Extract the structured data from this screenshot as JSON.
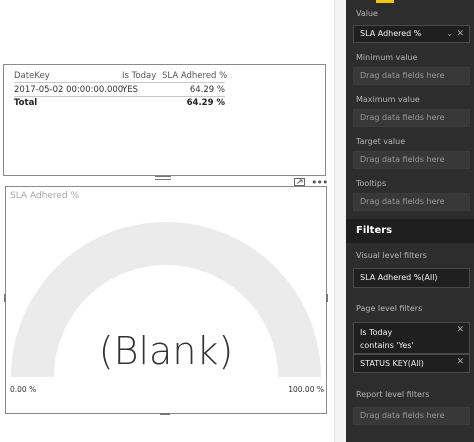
{
  "table": {
    "headers": [
      "DateKey",
      "Is Today",
      "SLA Adhered %"
    ],
    "rows": [
      [
        "2017-05-02 00:00:00.000",
        "YES",
        "64.29 %"
      ]
    ],
    "total": {
      "label": "Total",
      "value": "64.29 %"
    }
  },
  "gauge": {
    "title": "SLA Adhered %",
    "center_value": "(Blank)",
    "min_label": "0.00 %",
    "max_label": "100.00 %",
    "arc_color": "#ebebeb"
  },
  "pane": {
    "value_label": "Value",
    "value_field": "SLA Adhered %",
    "minimum_label": "Minimum value",
    "maximum_label": "Maximum value",
    "target_label": "Target value",
    "tooltips_label": "Tooltips",
    "drag_placeholder": "Drag data fields here",
    "filters_title": "Filters",
    "visual_filters_label": "Visual level filters",
    "visual_filter_1": "SLA Adhered %(All)",
    "page_filters_label": "Page level filters",
    "page_filter_1_name": "Is Today",
    "page_filter_1_condition": "contains 'Yes'",
    "page_filter_2": "STATUS KEY(All)",
    "report_filters_label": "Report level filters",
    "accent_color": "#f2c811"
  }
}
